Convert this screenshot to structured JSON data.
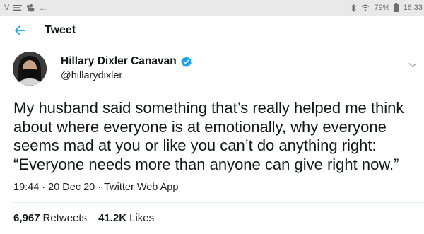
{
  "status_bar": {
    "left_glyphs": "V",
    "dots": "...",
    "battery": "79%",
    "time": "16:33"
  },
  "header": {
    "title": "Tweet"
  },
  "tweet": {
    "author_name": "Hillary Dixler Canavan",
    "author_handle": "@hillarydixler",
    "text_lines": [
      "My husband said something that’s really helped me think",
      "about where everyone is at emotionally, why everyone",
      "seems mad at you or like you can’t do anything right:",
      "“Everyone needs more than anyone can give right now.”"
    ],
    "time": "19:44",
    "date": "20 Dec 20",
    "source": "Twitter Web App",
    "separator": "·",
    "retweets_count": "6,967",
    "retweets_label": "Retweets",
    "likes_count": "41.2K",
    "likes_label": "Likes"
  },
  "colors": {
    "accent": "#1da1f2",
    "status_bar_bg": "#e9e9e9",
    "divider": "#e6ecf0"
  }
}
